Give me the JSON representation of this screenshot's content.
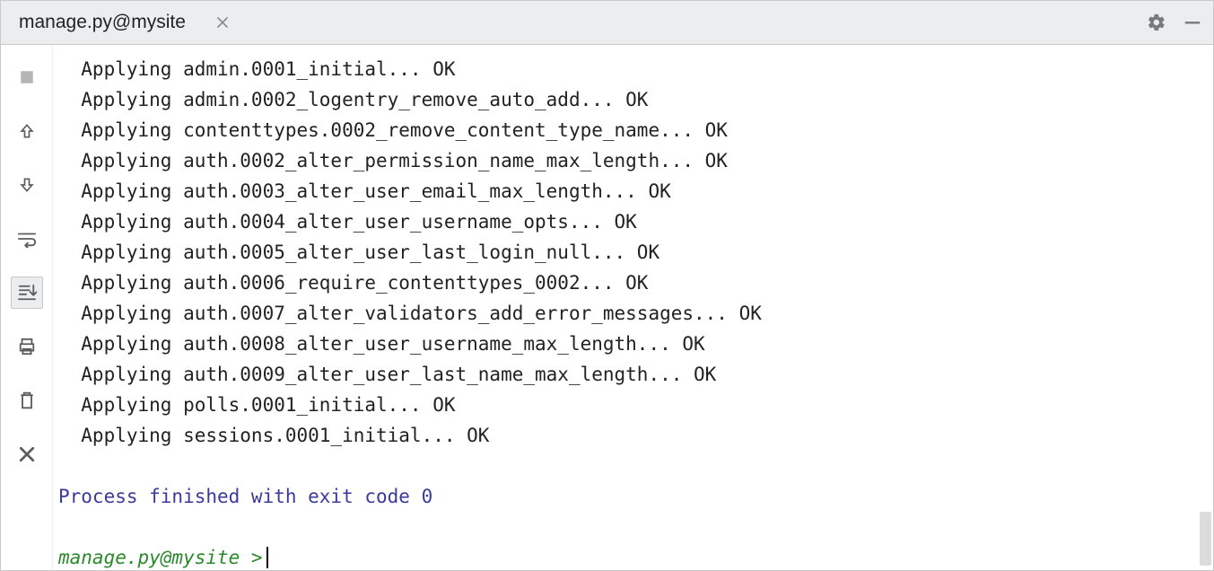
{
  "tab": {
    "title": "manage.py@mysite"
  },
  "output_lines": [
    "  Applying admin.0001_initial... OK",
    "  Applying admin.0002_logentry_remove_auto_add... OK",
    "  Applying contenttypes.0002_remove_content_type_name... OK",
    "  Applying auth.0002_alter_permission_name_max_length... OK",
    "  Applying auth.0003_alter_user_email_max_length... OK",
    "  Applying auth.0004_alter_user_username_opts... OK",
    "  Applying auth.0005_alter_user_last_login_null... OK",
    "  Applying auth.0006_require_contenttypes_0002... OK",
    "  Applying auth.0007_alter_validators_add_error_messages... OK",
    "  Applying auth.0008_alter_user_username_max_length... OK",
    "  Applying auth.0009_alter_user_last_name_max_length... OK",
    "  Applying polls.0001_initial... OK",
    "  Applying sessions.0001_initial... OK"
  ],
  "exit_message": "Process finished with exit code 0",
  "prompt": "manage.py@mysite > "
}
